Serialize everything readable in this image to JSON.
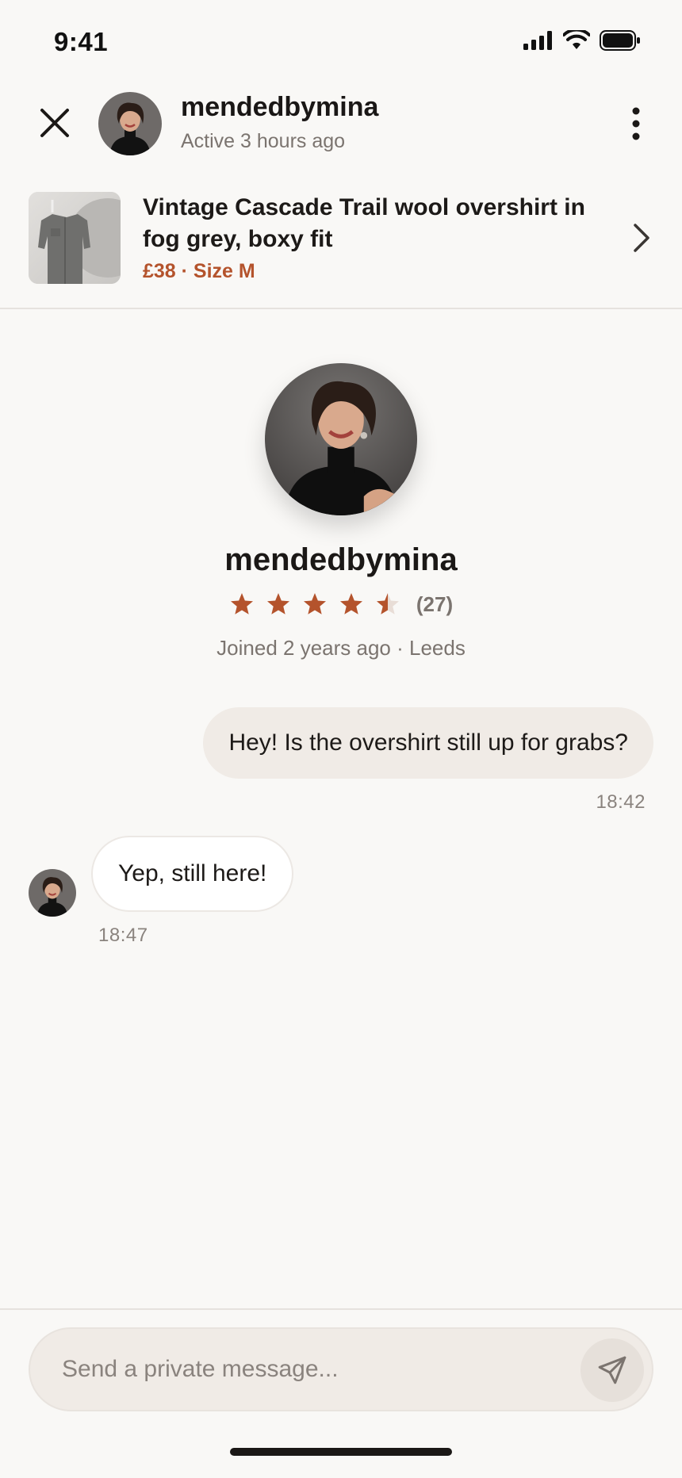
{
  "status_bar": {
    "time": "9:41"
  },
  "header": {
    "username": "mendedbymina",
    "active_status": "Active 3 hours ago"
  },
  "listing": {
    "title": "Vintage Cascade Trail wool overshirt in fog grey, boxy fit",
    "meta": "£38 · Size M"
  },
  "profile": {
    "username": "mendedbymina",
    "rating": 4.5,
    "rating_max": 5,
    "rating_count": "(27)",
    "joined": "Joined 2 years ago · Leeds"
  },
  "messages": [
    {
      "direction": "outgoing",
      "text": "Hey! Is the overshirt still up for grabs?",
      "time": "18:42"
    },
    {
      "direction": "incoming",
      "text": "Yep, still here!",
      "time": "18:47"
    }
  ],
  "composer": {
    "placeholder": "Send a private message..."
  },
  "colors": {
    "accent": "#b4532c",
    "background": "#f9f8f6",
    "outgoing_bubble": "#f0ebe6",
    "incoming_bubble": "#ffffff",
    "muted_text": "#7b746f"
  },
  "icons": {
    "close": "close-icon",
    "more": "more-vertical-icon",
    "chevron": "chevron-right-icon",
    "send": "send-icon",
    "star": "star-icon"
  }
}
